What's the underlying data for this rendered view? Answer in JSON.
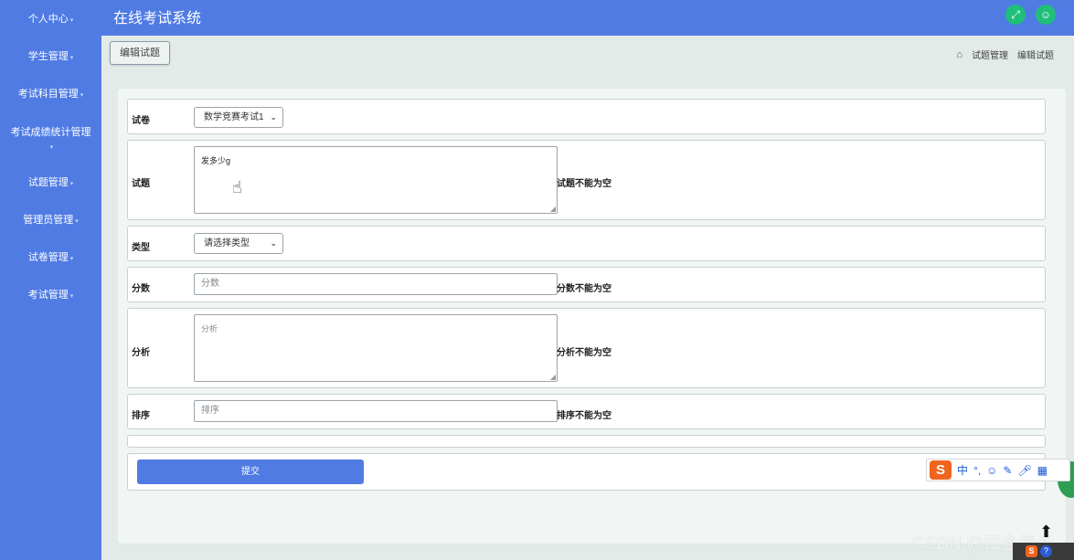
{
  "app": {
    "title": "在线考试系统"
  },
  "sidebar": {
    "items": [
      {
        "label": "个人中心"
      },
      {
        "label": "学生管理"
      },
      {
        "label": "考试科目管理"
      },
      {
        "label": "考试成绩统计管理"
      },
      {
        "label": "试题管理"
      },
      {
        "label": "管理员管理"
      },
      {
        "label": "试卷管理"
      },
      {
        "label": "考试管理"
      }
    ]
  },
  "page": {
    "title": "编辑试题",
    "breadcrumb": [
      "试题管理",
      "编辑试题"
    ]
  },
  "form": {
    "paper": {
      "label": "试卷",
      "value": "数学竞赛考试1"
    },
    "question": {
      "label": "试题",
      "value": "发多少g",
      "error": "试题不能为空"
    },
    "type": {
      "label": "类型",
      "value": "请选择类型"
    },
    "score": {
      "label": "分数",
      "placeholder": "分数",
      "error": "分数不能为空"
    },
    "analysis": {
      "label": "分析",
      "placeholder": "分析",
      "error": "分析不能为空"
    },
    "order": {
      "label": "排序",
      "placeholder": "排序",
      "error": "排序不能为空"
    },
    "submit_label": "提交"
  },
  "ime": {
    "mode": "中",
    "punct": "°,"
  },
  "watermark": "CSDN @四金学长",
  "colors": {
    "primary": "#4f7be3",
    "accent_green": "#1fbf7a",
    "ime_orange": "#f0641e"
  }
}
